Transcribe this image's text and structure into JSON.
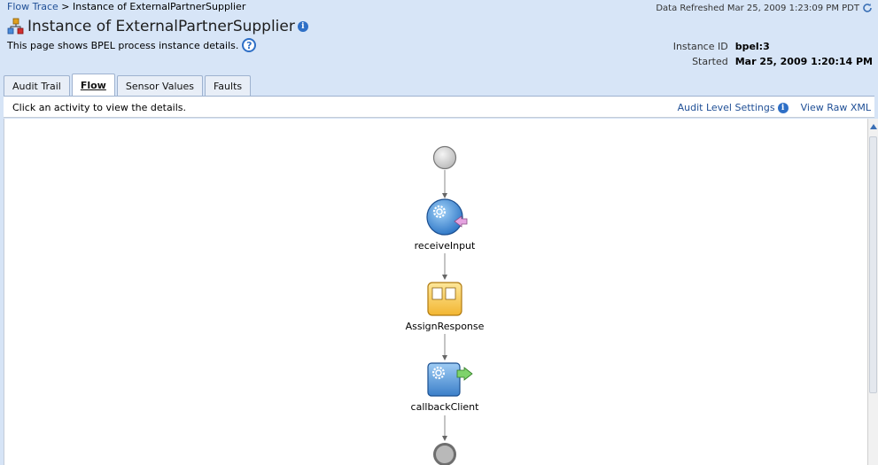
{
  "breadcrumb": {
    "root": "Flow Trace",
    "separator": ">",
    "current": "Instance of ExternalPartnerSupplier"
  },
  "refresh": {
    "text": "Data Refreshed Mar 25, 2009 1:23:09 PM PDT"
  },
  "page": {
    "title": "Instance of ExternalPartnerSupplier",
    "description": "This page shows BPEL process instance details."
  },
  "meta": {
    "instance_id_label": "Instance ID",
    "instance_id_value": "bpel:3",
    "started_label": "Started",
    "started_value": "Mar 25, 2009 1:20:14 PM"
  },
  "tabs": [
    {
      "label": "Audit Trail"
    },
    {
      "label": "Flow",
      "active": true
    },
    {
      "label": "Sensor Values"
    },
    {
      "label": "Faults"
    }
  ],
  "toolbar": {
    "hint": "Click an activity to view the details.",
    "audit_link": "Audit Level Settings",
    "raw_xml_link": "View Raw XML"
  },
  "flow": {
    "nodes": [
      {
        "id": "start",
        "type": "start"
      },
      {
        "id": "receiveInput",
        "type": "receive",
        "label": "receiveInput"
      },
      {
        "id": "AssignResponse",
        "type": "assign",
        "label": "AssignResponse"
      },
      {
        "id": "callbackClient",
        "type": "invoke",
        "label": "callbackClient"
      },
      {
        "id": "end",
        "type": "end"
      }
    ]
  },
  "colors": {
    "link": "#1f4f96",
    "header_bg": "#d7e5f7",
    "tab_border": "#9eb2cf"
  }
}
